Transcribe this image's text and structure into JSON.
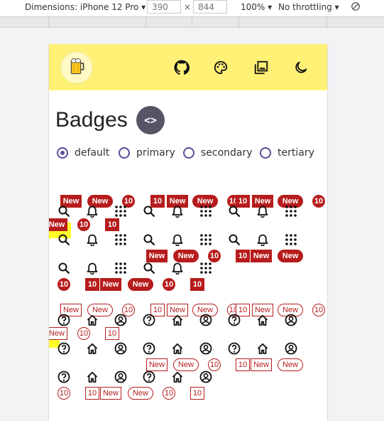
{
  "devtools": {
    "dimensions_label": "Dimensions: iPhone 12 Pro ▾",
    "width": "390",
    "times": "×",
    "height": "844",
    "zoom": "100% ▾",
    "throttle": "No throttling ▾"
  },
  "page": {
    "title": "Badges",
    "code_button": "<>",
    "radios": [
      {
        "label": "default",
        "checked": true
      },
      {
        "label": "primary",
        "checked": false
      },
      {
        "label": "secondary",
        "checked": false
      },
      {
        "label": "tertiary",
        "checked": false
      }
    ],
    "badge_new": "New",
    "badge_count": "10"
  },
  "colors": {
    "appbar": "#fff176",
    "badge": "#b71c1c",
    "radio": "#5b4c9b",
    "highlight": "#ffff00"
  },
  "icons": {
    "appbar": [
      "github-icon",
      "palette-icon",
      "photo-library-icon",
      "dark-mode-icon"
    ],
    "filled_group": [
      "search-icon",
      "bell-icon",
      "apps-grid-icon"
    ],
    "outlined_group": [
      "help-icon",
      "home-icon",
      "account-circle-icon"
    ]
  }
}
